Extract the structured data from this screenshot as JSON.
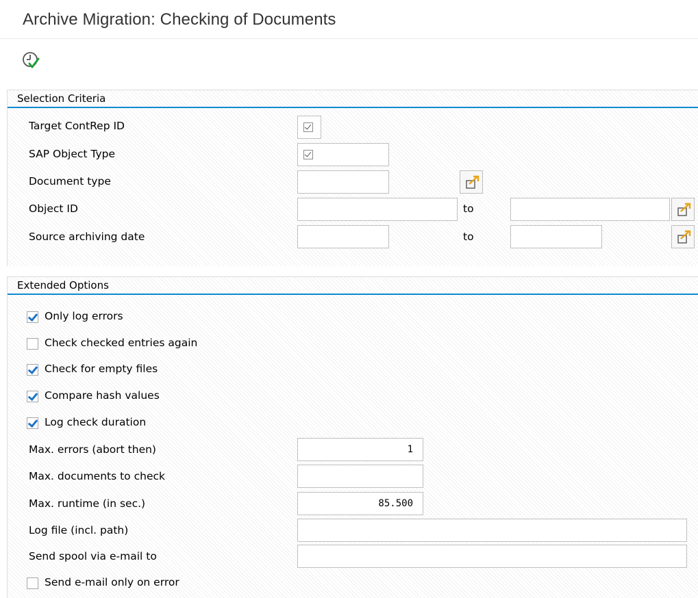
{
  "title": "Archive Migration: Checking of Documents",
  "toolbar": {
    "execute_icon": "execute-clock-check-icon"
  },
  "selection": {
    "header": "Selection Criteria",
    "to_label": "to",
    "rows": {
      "target_contrep_id": "Target ContRep ID",
      "sap_object_type": "SAP Object Type",
      "document_type": "Document type",
      "object_id": "Object ID",
      "source_archiving_date": "Source archiving date"
    }
  },
  "extended": {
    "header": "Extended Options",
    "checkboxes": {
      "only_log_errors": {
        "label": "Only log errors",
        "checked": true
      },
      "check_checked_entries_again": {
        "label": "Check checked entries again",
        "checked": false
      },
      "check_for_empty_files": {
        "label": "Check for empty files",
        "checked": true
      },
      "compare_hash_values": {
        "label": "Compare hash values",
        "checked": true
      },
      "log_check_duration": {
        "label": "Log check duration",
        "checked": true
      },
      "send_email_only_on_error": {
        "label": "Send e-mail only on error",
        "checked": false
      }
    },
    "fields": {
      "max_errors": {
        "label": "Max. errors (abort then)",
        "value": "1"
      },
      "max_documents": {
        "label": "Max. documents to check",
        "value": ""
      },
      "max_runtime": {
        "label": "Max. runtime (in sec.)",
        "value": "85.500"
      },
      "log_file": {
        "label": "Log file (incl. path)",
        "value": ""
      },
      "send_spool": {
        "label": "Send spool via e-mail to",
        "value": ""
      }
    }
  },
  "colors": {
    "accent_line": "#0a8bd0",
    "checkbox_check": "#1f74c8",
    "execute_icon_green": "#1e9f3c",
    "multisel_arrow": "#e8a317"
  }
}
